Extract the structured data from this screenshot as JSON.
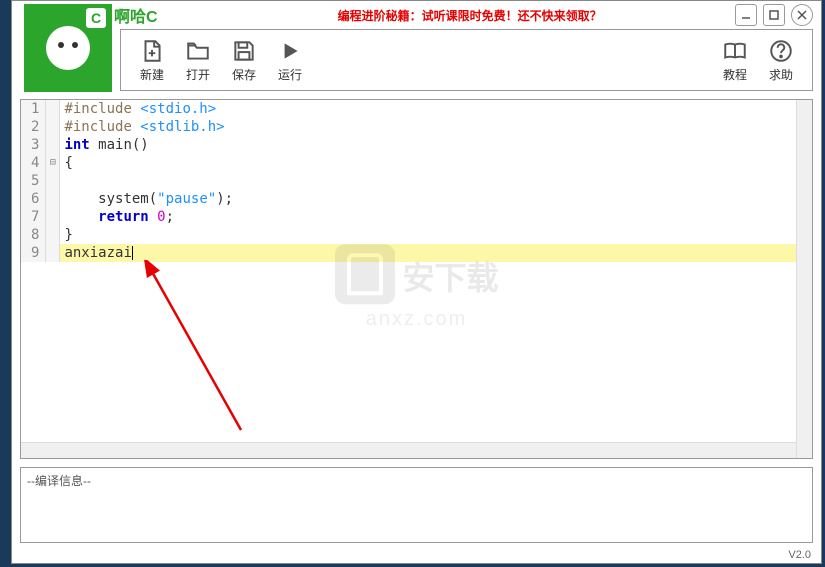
{
  "app_title": "啊哈C",
  "promo_text": "编程进阶秘籍：试听课限时免费！还不快来领取？",
  "logo_letter": "C",
  "toolbar": {
    "new_label": "新建",
    "open_label": "打开",
    "save_label": "保存",
    "run_label": "运行",
    "tutorial_label": "教程",
    "help_label": "求助"
  },
  "code": {
    "lines": [
      {
        "n": "1",
        "pre": "#include ",
        "angle": "<stdio.h>"
      },
      {
        "n": "2",
        "pre": "#include ",
        "angle": "<stdlib.h>"
      },
      {
        "n": "3",
        "blue": "int ",
        "txt": "main()"
      },
      {
        "n": "4",
        "txt": "{"
      },
      {
        "n": "5",
        "txt": ""
      },
      {
        "n": "6",
        "indent": "    ",
        "txt1": "system(",
        "str": "\"pause\"",
        "txt2": ");"
      },
      {
        "n": "7",
        "indent": "    ",
        "blue": "return ",
        "num": "0",
        "txt": ";"
      },
      {
        "n": "8",
        "txt": "}"
      },
      {
        "n": "9",
        "txt": "anxiazai",
        "current": true
      }
    ],
    "fold_marker": "⊟"
  },
  "watermark": {
    "text1": "安下载",
    "text2": "anxz.com"
  },
  "output_label": "--编译信息--",
  "version": "V2.0"
}
